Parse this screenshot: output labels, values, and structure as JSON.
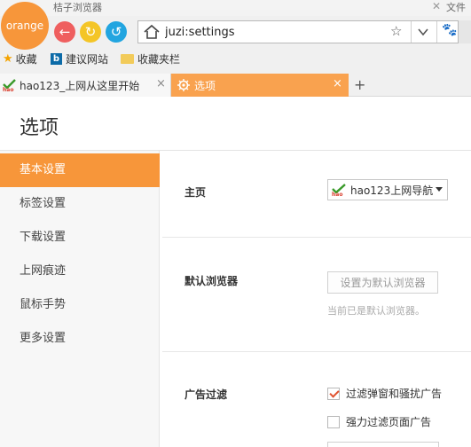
{
  "window": {
    "app_title": "桔子浏览器",
    "close_glyph": "✕",
    "right_label": "文件"
  },
  "logo": {
    "text": "orange"
  },
  "nav": {
    "back_glyph": "←",
    "reload_glyph": "↻",
    "undo_glyph": "↺"
  },
  "address": {
    "url": "juzi:settings",
    "star_glyph": "☆",
    "paw_glyph": "🐾"
  },
  "bookmarks": {
    "items": [
      {
        "label": "收藏",
        "icon": "star-icon"
      },
      {
        "label": "建议网站",
        "icon": "bing-icon"
      },
      {
        "label": "收藏夹栏",
        "icon": "folder-icon"
      }
    ]
  },
  "tabs": [
    {
      "label": "hao123_上网从这里开始",
      "icon": "hao123-icon",
      "close_glyph": "×"
    },
    {
      "label": "选项",
      "icon": "gear-icon",
      "close_glyph": "×",
      "active": true
    }
  ],
  "newtab_glyph": "+",
  "page": {
    "title": "选项"
  },
  "sidebar": {
    "items": [
      {
        "label": "基本设置",
        "active": true
      },
      {
        "label": "标签设置"
      },
      {
        "label": "下载设置"
      },
      {
        "label": "上网痕迹"
      },
      {
        "label": "鼠标手势"
      },
      {
        "label": "更多设置"
      }
    ]
  },
  "settings": {
    "home": {
      "label": "主页",
      "selected": "hao123上网导航"
    },
    "default_browser": {
      "label": "默认浏览器",
      "button": "设置为默认浏览器",
      "status": "当前已是默认浏览器。"
    },
    "adblock": {
      "label": "广告过滤",
      "options": [
        {
          "label": "过滤弹窗和骚扰广告",
          "checked": true
        },
        {
          "label": "强力过滤页面广告",
          "checked": false
        }
      ]
    }
  },
  "colors": {
    "accent": "#f7963a",
    "tab_active": "#f9a24f",
    "back": "#ef5f5f",
    "reload": "#f4c526",
    "undo": "#22a5e0"
  }
}
